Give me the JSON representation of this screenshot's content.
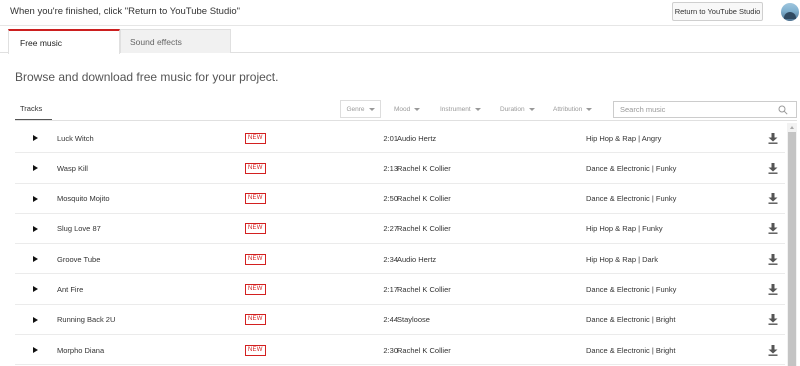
{
  "banner": {
    "text": "When you're finished, click \"Return to YouTube Studio\"",
    "return_button": "Return to YouTube Studio"
  },
  "tabs": [
    {
      "label": "Free music",
      "active": true
    },
    {
      "label": "Sound effects",
      "active": false
    }
  ],
  "heading": "Browse and download free music for your project.",
  "toolbar": {
    "tracks_tab": "Tracks",
    "filters": [
      "Genre",
      "Mood",
      "Instrument",
      "Duration",
      "Attribution"
    ],
    "search_placeholder": "Search music"
  },
  "colors": {
    "accent": "#cc1f1f",
    "badge": "#d32020"
  },
  "tracks": [
    {
      "title": "Luck Witch",
      "badge": "NEW",
      "duration": "2:01",
      "artist": "Audio Hertz",
      "genre_mood": "Hip Hop & Rap | Angry"
    },
    {
      "title": "Wasp Kill",
      "badge": "NEW",
      "duration": "2:13",
      "artist": "Rachel K Collier",
      "genre_mood": "Dance & Electronic | Funky"
    },
    {
      "title": "Mosquito Mojito",
      "badge": "NEW",
      "duration": "2:50",
      "artist": "Rachel K Collier",
      "genre_mood": "Dance & Electronic | Funky"
    },
    {
      "title": "Slug Love 87",
      "badge": "NEW",
      "duration": "2:27",
      "artist": "Rachel K Collier",
      "genre_mood": "Hip Hop & Rap | Funky"
    },
    {
      "title": "Groove Tube",
      "badge": "NEW",
      "duration": "2:34",
      "artist": "Audio Hertz",
      "genre_mood": "Hip Hop & Rap | Dark"
    },
    {
      "title": "Ant Fire",
      "badge": "NEW",
      "duration": "2:17",
      "artist": "Rachel K Collier",
      "genre_mood": "Dance & Electronic | Funky"
    },
    {
      "title": "Running Back 2U",
      "badge": "NEW",
      "duration": "2:44",
      "artist": "Stayloose",
      "genre_mood": "Dance & Electronic | Bright"
    },
    {
      "title": "Morpho Diana",
      "badge": "NEW",
      "duration": "2:30",
      "artist": "Rachel K Collier",
      "genre_mood": "Dance & Electronic | Bright"
    }
  ]
}
